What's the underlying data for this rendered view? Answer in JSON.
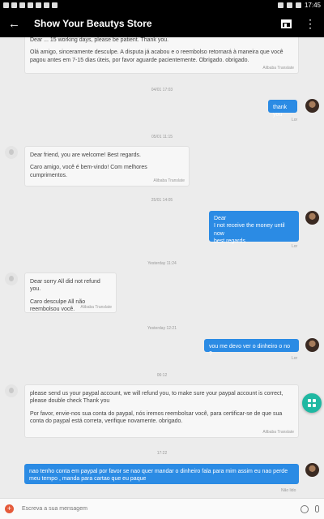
{
  "status_bar": {
    "time": "17:45"
  },
  "app_bar": {
    "title": "Show Your Beautys Store"
  },
  "messages": {
    "m1": {
      "text_partial": "Dear ... 15 working days, please be patient. Thank you.",
      "text_pt": "Olá amigo, sinceramente desculpe. A disputa já acabou e o reembolso retornará à maneira que você pagou antes em 7-15 dias úteis, por favor aguarde pacientemente. Obrigado. obrigado.",
      "translate": "Alibaba Translate"
    },
    "ts1": "04/01 17:03",
    "m2": {
      "text": "thank you",
      "read": "Lor"
    },
    "ts2": "05/01 11:15",
    "m3": {
      "text_en": "Dear friend, you are welcome! Best regards.",
      "text_pt": "Caro amigo, você é bem-vindo! Com melhores cumprimentos.",
      "translate": "Alibaba Translate"
    },
    "ts3": "25/01 14:05",
    "m4": {
      "lines": [
        "Dear",
        "I not receive the money until now",
        "best regards"
      ],
      "read": "Lor"
    },
    "ts4": "Yesterday 11:24",
    "m5": {
      "text_en": "Dear sorry All did not refund you.",
      "text_pt": "Caro desculpe All não reembolsou você.",
      "translate": "Alibaba Translate"
    },
    "ts5": "Yesterday 12:21",
    "m6": {
      "text": "vou me devo ver o dinheiro o no ?",
      "read": "Lor"
    },
    "ts6": "06:12",
    "m7": {
      "text_en": "please send us your paypal account, we will refund you, to make sure your paypal account is correct, please double check Thank you",
      "text_pt": "Por favor, envie-nos sua conta do paypal, nós iremos reembolsar você, para certificar-se de que sua conta do paypal está correta, verifique novamente. obrigado.",
      "translate": "Alibaba Translate"
    },
    "ts7": "17:22",
    "m8": {
      "text": "nao tenho conta em paypal por favor se nao quer mandar o dinheiro fala para mim assim eu nao perde meu tempo , manda para cartao que eu paque",
      "read": "Não lido"
    }
  },
  "input": {
    "placeholder": "Escreva a sua mensagem"
  },
  "colors": {
    "accent": "#2b8be4",
    "fab": "#1fb8a2",
    "plus": "#e55a3a"
  }
}
